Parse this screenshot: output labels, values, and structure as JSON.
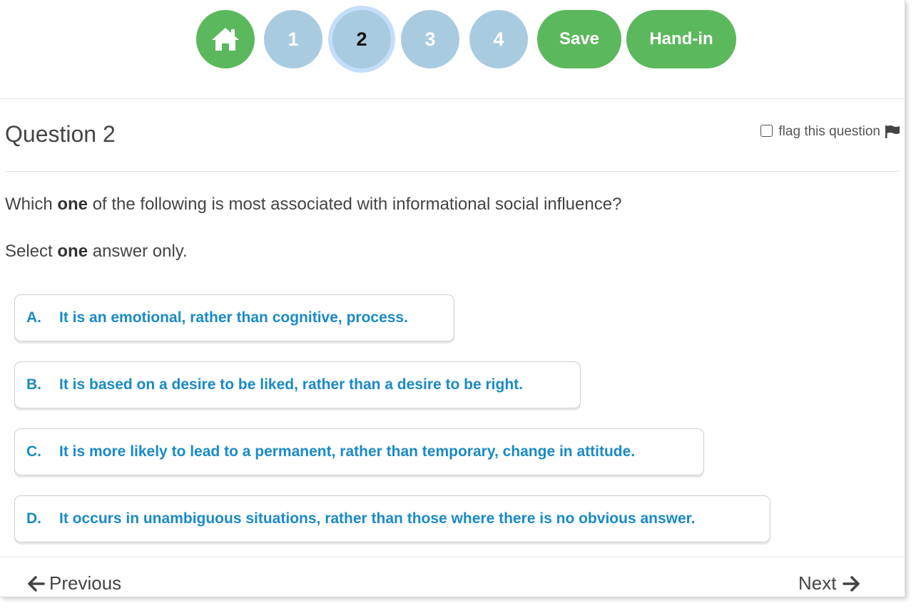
{
  "nav": {
    "home_icon": "home-icon",
    "question_numbers": [
      "1",
      "2",
      "3",
      "4"
    ],
    "current_question": "2",
    "save_label": "Save",
    "handin_label": "Hand-in",
    "colors": {
      "green": "#5cb85c",
      "unvisited_blue": "#a9cbe0",
      "current_ring": "#c4defa"
    }
  },
  "question": {
    "title": "Question 2",
    "flag_label": "flag this question",
    "flag_checked": false,
    "flag_icon": "flag-icon",
    "stem_before": "Which ",
    "stem_bold": "one",
    "stem_after": " of the following is most associated with informational social influence?",
    "instruction_before": "Select ",
    "instruction_bold": "one",
    "instruction_after": " answer only."
  },
  "options": [
    {
      "letter": "A.",
      "text": "It is an emotional, rather than cognitive, process."
    },
    {
      "letter": "B.",
      "text": "It is based on a desire to be liked, rather than a desire to be right."
    },
    {
      "letter": "C.",
      "text": "It is more likely to lead to a permanent, rather than temporary, change in attitude."
    },
    {
      "letter": "D.",
      "text": "It occurs in unambiguous situations, rather than those where there is no obvious answer."
    }
  ],
  "footer": {
    "previous_label": "Previous",
    "next_label": "Next",
    "previous_icon": "arrow-left-icon",
    "next_icon": "arrow-right-icon"
  },
  "colors": {
    "option_text": "#1a8ac6",
    "body_text": "#444444"
  }
}
